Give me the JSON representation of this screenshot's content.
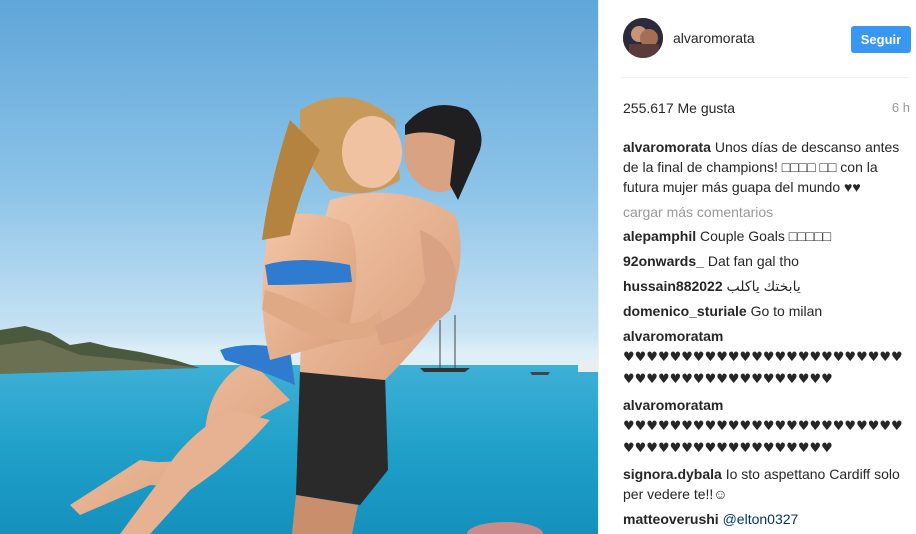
{
  "post": {
    "username": "alvaromorata",
    "follow_label": "Seguir",
    "likes": "255.617 Me gusta",
    "time_ago": "6 h",
    "caption_user": "alvaromorata",
    "caption_text": "Unos días de descanso antes de la final de champions! □□□□ □□ con la futura mujer más guapa del mundo ♥♥",
    "load_more": "cargar más comentarios"
  },
  "comments": [
    {
      "user": "alepamphil",
      "text": "Couple Goals □□□□□"
    },
    {
      "user": "92onwards_",
      "text": "Dat fan gal tho"
    },
    {
      "user": "hussain882022",
      "text": "يابختك ياكلب"
    },
    {
      "user": "domenico_sturiale",
      "text": "Go to milan"
    },
    {
      "user": "alvaromoratam",
      "text": "♥♥♥♥♥♥♥♥♥♥♥♥♥♥♥♥♥♥♥♥♥♥♥♥♥♥♥♥♥♥♥♥♥♥♥♥♥♥♥♥♥♥"
    },
    {
      "user": "alvaromoratam",
      "text": "♥♥♥♥♥♥♥♥♥♥♥♥♥♥♥♥♥♥♥♥♥♥♥♥♥♥♥♥♥♥♥♥♥♥♥♥♥♥♥♥♥♥"
    },
    {
      "user": "signora.dybala",
      "text": "Io sto aspettano Cardiff solo per vedere te!!☺"
    },
    {
      "user": "matteoverushi",
      "text": "@elton0327"
    }
  ],
  "colors": {
    "accent": "#3897f0",
    "muted": "#999999",
    "mention": "#003569"
  }
}
